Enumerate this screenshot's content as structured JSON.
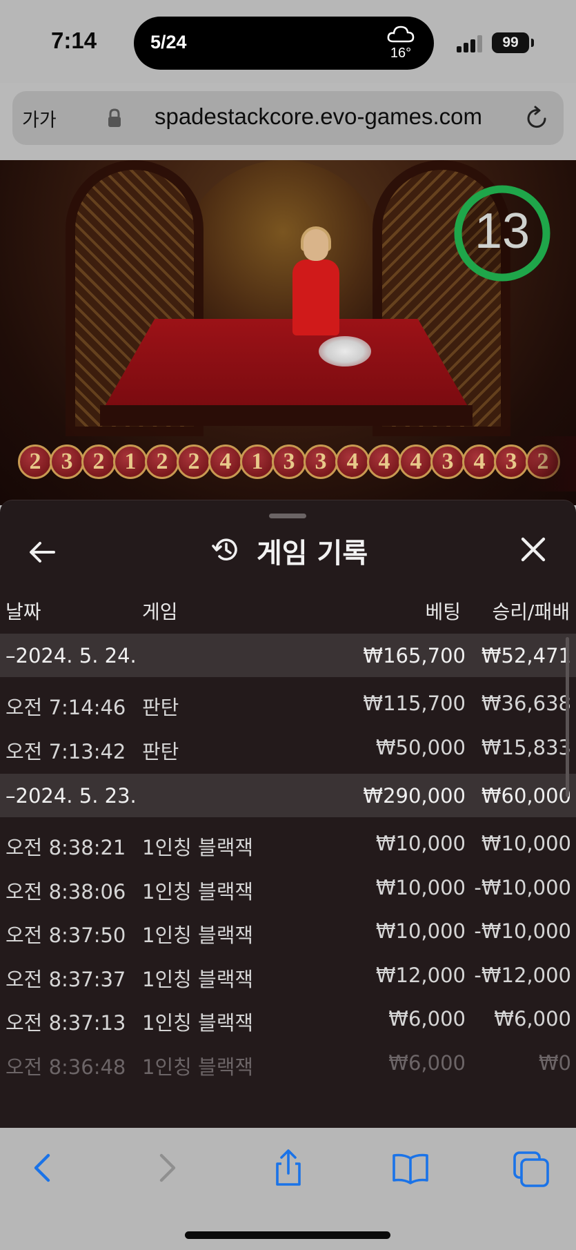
{
  "status_bar": {
    "time": "7:14",
    "island_date": "5/24",
    "weather_temp": "16°",
    "battery": "99"
  },
  "browser": {
    "aa_label": "가가",
    "url": "spadestackcore.evo-games.com"
  },
  "game": {
    "timer": "13",
    "road_numbers": [
      "2",
      "3",
      "2",
      "1",
      "2",
      "2",
      "4",
      "1",
      "3",
      "3",
      "4",
      "4",
      "4",
      "3",
      "4",
      "3",
      "2"
    ]
  },
  "history": {
    "title": "게임 기록",
    "columns": {
      "date": "날짜",
      "game": "게임",
      "bet": "베팅",
      "win_loss": "승리/패배"
    },
    "groups": [
      {
        "date": "–2024. 5. 24.",
        "bet": "₩165,700",
        "win_loss": "₩52,471",
        "rows": [
          {
            "time": "오전 7:14:46",
            "game": "판탄",
            "bet": "₩115,700",
            "win_loss": "₩36,638"
          },
          {
            "time": "오전 7:13:42",
            "game": "판탄",
            "bet": "₩50,000",
            "win_loss": "₩15,833"
          }
        ]
      },
      {
        "date": "–2024. 5. 23.",
        "bet": "₩290,000",
        "win_loss": "₩60,000",
        "rows": [
          {
            "time": "오전 8:38:21",
            "game": "1인칭 블랙잭",
            "bet": "₩10,000",
            "win_loss": "₩10,000"
          },
          {
            "time": "오전 8:38:06",
            "game": "1인칭 블랙잭",
            "bet": "₩10,000",
            "win_loss": "-₩10,000"
          },
          {
            "time": "오전 8:37:50",
            "game": "1인칭 블랙잭",
            "bet": "₩10,000",
            "win_loss": "-₩10,000"
          },
          {
            "time": "오전 8:37:37",
            "game": "1인칭 블랙잭",
            "bet": "₩12,000",
            "win_loss": "-₩12,000"
          },
          {
            "time": "오전 8:37:13",
            "game": "1인칭 블랙잭",
            "bet": "₩6,000",
            "win_loss": "₩6,000"
          },
          {
            "time": "오전 8:36:48",
            "game": "1인칭 블랙잭",
            "bet": "₩6,000",
            "win_loss": "₩0"
          }
        ]
      }
    ]
  },
  "colors": {
    "sheet_bg": "#231a1b",
    "group_row_bg": "#3a3334",
    "timer_ring": "#1fa64a",
    "ios_blue": "#1a73e8"
  },
  "icons": {
    "back": "arrow-left-icon",
    "history": "history-clock-icon",
    "close": "close-icon",
    "lock": "lock-icon",
    "reload": "reload-icon"
  }
}
